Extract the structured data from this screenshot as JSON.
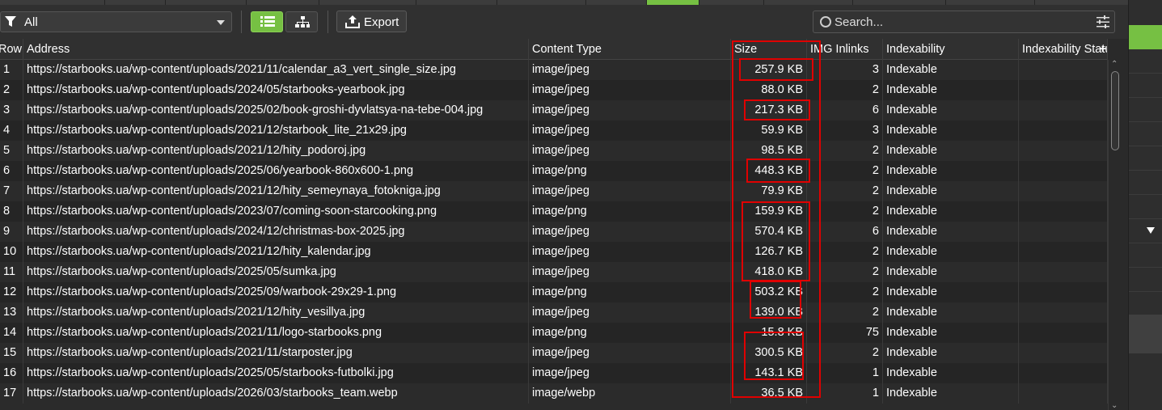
{
  "filter": {
    "selected": "All"
  },
  "toolbar": {
    "export_label": "Export"
  },
  "search": {
    "placeholder": "Search..."
  },
  "columns": {
    "row": "Row",
    "address": "Address",
    "content_type": "Content Type",
    "size": "Size",
    "img_inlinks": "IMG Inlinks",
    "indexability": "Indexability",
    "indexability_status": "Indexability Status"
  },
  "rows": [
    {
      "n": "1",
      "address": "https://starbooks.ua/wp-content/uploads/2021/11/calendar_a3_vert_single_size.jpg",
      "type": "image/jpeg",
      "size": "257.9 KB",
      "inlinks": "3",
      "idx": "Indexable"
    },
    {
      "n": "2",
      "address": "https://starbooks.ua/wp-content/uploads/2024/05/starbooks-yearbook.jpg",
      "type": "image/jpeg",
      "size": "88.0 KB",
      "inlinks": "2",
      "idx": "Indexable"
    },
    {
      "n": "3",
      "address": "https://starbooks.ua/wp-content/uploads/2025/02/book-groshi-dyvlatsya-na-tebe-004.jpg",
      "type": "image/jpeg",
      "size": "217.3 KB",
      "inlinks": "6",
      "idx": "Indexable"
    },
    {
      "n": "4",
      "address": "https://starbooks.ua/wp-content/uploads/2021/12/starbook_lite_21x29.jpg",
      "type": "image/jpeg",
      "size": "59.9 KB",
      "inlinks": "3",
      "idx": "Indexable"
    },
    {
      "n": "5",
      "address": "https://starbooks.ua/wp-content/uploads/2021/12/hity_podoroj.jpg",
      "type": "image/jpeg",
      "size": "98.5 KB",
      "inlinks": "2",
      "idx": "Indexable"
    },
    {
      "n": "6",
      "address": "https://starbooks.ua/wp-content/uploads/2025/06/yearbook-860x600-1.png",
      "type": "image/png",
      "size": "448.3 KB",
      "inlinks": "2",
      "idx": "Indexable"
    },
    {
      "n": "7",
      "address": "https://starbooks.ua/wp-content/uploads/2021/12/hity_semeynaya_fotokniga.jpg",
      "type": "image/jpeg",
      "size": "79.9 KB",
      "inlinks": "2",
      "idx": "Indexable"
    },
    {
      "n": "8",
      "address": "https://starbooks.ua/wp-content/uploads/2023/07/coming-soon-starcooking.png",
      "type": "image/png",
      "size": "159.9 KB",
      "inlinks": "2",
      "idx": "Indexable"
    },
    {
      "n": "9",
      "address": "https://starbooks.ua/wp-content/uploads/2024/12/christmas-box-2025.jpg",
      "type": "image/jpeg",
      "size": "570.4 KB",
      "inlinks": "6",
      "idx": "Indexable"
    },
    {
      "n": "10",
      "address": "https://starbooks.ua/wp-content/uploads/2021/12/hity_kalendar.jpg",
      "type": "image/jpeg",
      "size": "126.7 KB",
      "inlinks": "2",
      "idx": "Indexable"
    },
    {
      "n": "11",
      "address": "https://starbooks.ua/wp-content/uploads/2025/05/sumka.jpg",
      "type": "image/jpeg",
      "size": "418.0 KB",
      "inlinks": "2",
      "idx": "Indexable"
    },
    {
      "n": "12",
      "address": "https://starbooks.ua/wp-content/uploads/2025/09/warbook-29x29-1.png",
      "type": "image/png",
      "size": "503.2 KB",
      "inlinks": "2",
      "idx": "Indexable"
    },
    {
      "n": "13",
      "address": "https://starbooks.ua/wp-content/uploads/2021/12/hity_vesillya.jpg",
      "type": "image/jpeg",
      "size": "139.0 KB",
      "inlinks": "2",
      "idx": "Indexable"
    },
    {
      "n": "14",
      "address": "https://starbooks.ua/wp-content/uploads/2021/11/logo-starbooks.png",
      "type": "image/png",
      "size": "15.8 KB",
      "inlinks": "75",
      "idx": "Indexable"
    },
    {
      "n": "15",
      "address": "https://starbooks.ua/wp-content/uploads/2021/11/starposter.jpg",
      "type": "image/jpeg",
      "size": "300.5 KB",
      "inlinks": "2",
      "idx": "Indexable"
    },
    {
      "n": "16",
      "address": "https://starbooks.ua/wp-content/uploads/2025/05/starbooks-futbolki.jpg",
      "type": "image/jpeg",
      "size": "143.1 KB",
      "inlinks": "1",
      "idx": "Indexable"
    },
    {
      "n": "17",
      "address": "https://starbooks.ua/wp-content/uploads/2026/03/starbooks_team.webp",
      "type": "image/webp",
      "size": "36.5 KB",
      "inlinks": "1",
      "idx": "Indexable"
    }
  ],
  "icons": [
    "filter-icon",
    "list-view-icon",
    "tree-view-icon",
    "export-icon",
    "search-icon",
    "settings-sliders-icon",
    "add-column-icon"
  ],
  "colors": {
    "accent": "#76c043",
    "annotation": "#e00000",
    "background": "#2b2b2b"
  }
}
